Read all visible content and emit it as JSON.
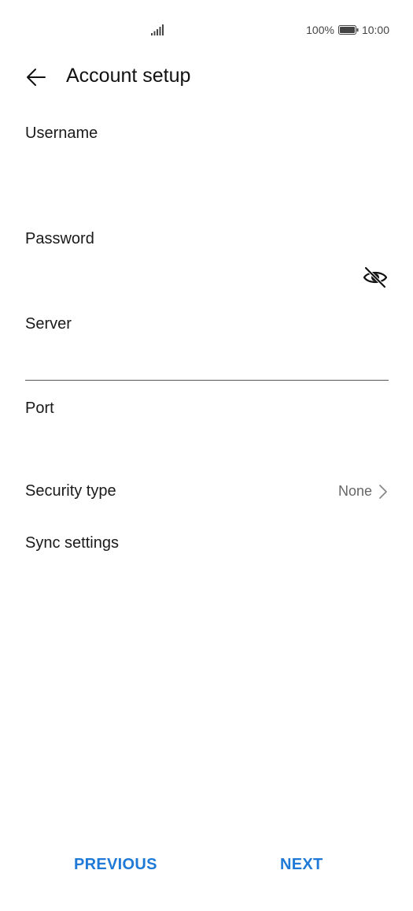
{
  "status_bar": {
    "battery_percent": "100%",
    "time": "10:00",
    "signal_icon": "cellular-signal-icon",
    "battery_icon": "battery-full-icon"
  },
  "header": {
    "back_icon": "arrow-left-icon",
    "title": "Account setup"
  },
  "fields": {
    "username": {
      "label": "Username",
      "value": ""
    },
    "password": {
      "label": "Password",
      "value": "",
      "toggle_icon": "eye-slash-icon"
    },
    "server": {
      "label": "Server",
      "value": ""
    },
    "port": {
      "label": "Port",
      "value": ""
    }
  },
  "security": {
    "label": "Security type",
    "value": "None",
    "chevron_icon": "chevron-right-icon"
  },
  "sync": {
    "label": "Sync settings"
  },
  "footer": {
    "previous_label": "PREVIOUS",
    "next_label": "NEXT"
  },
  "colors": {
    "accent": "#1e7ad6",
    "text": "#1a1a1a",
    "secondary_text": "#666666",
    "underline": "#555555"
  }
}
